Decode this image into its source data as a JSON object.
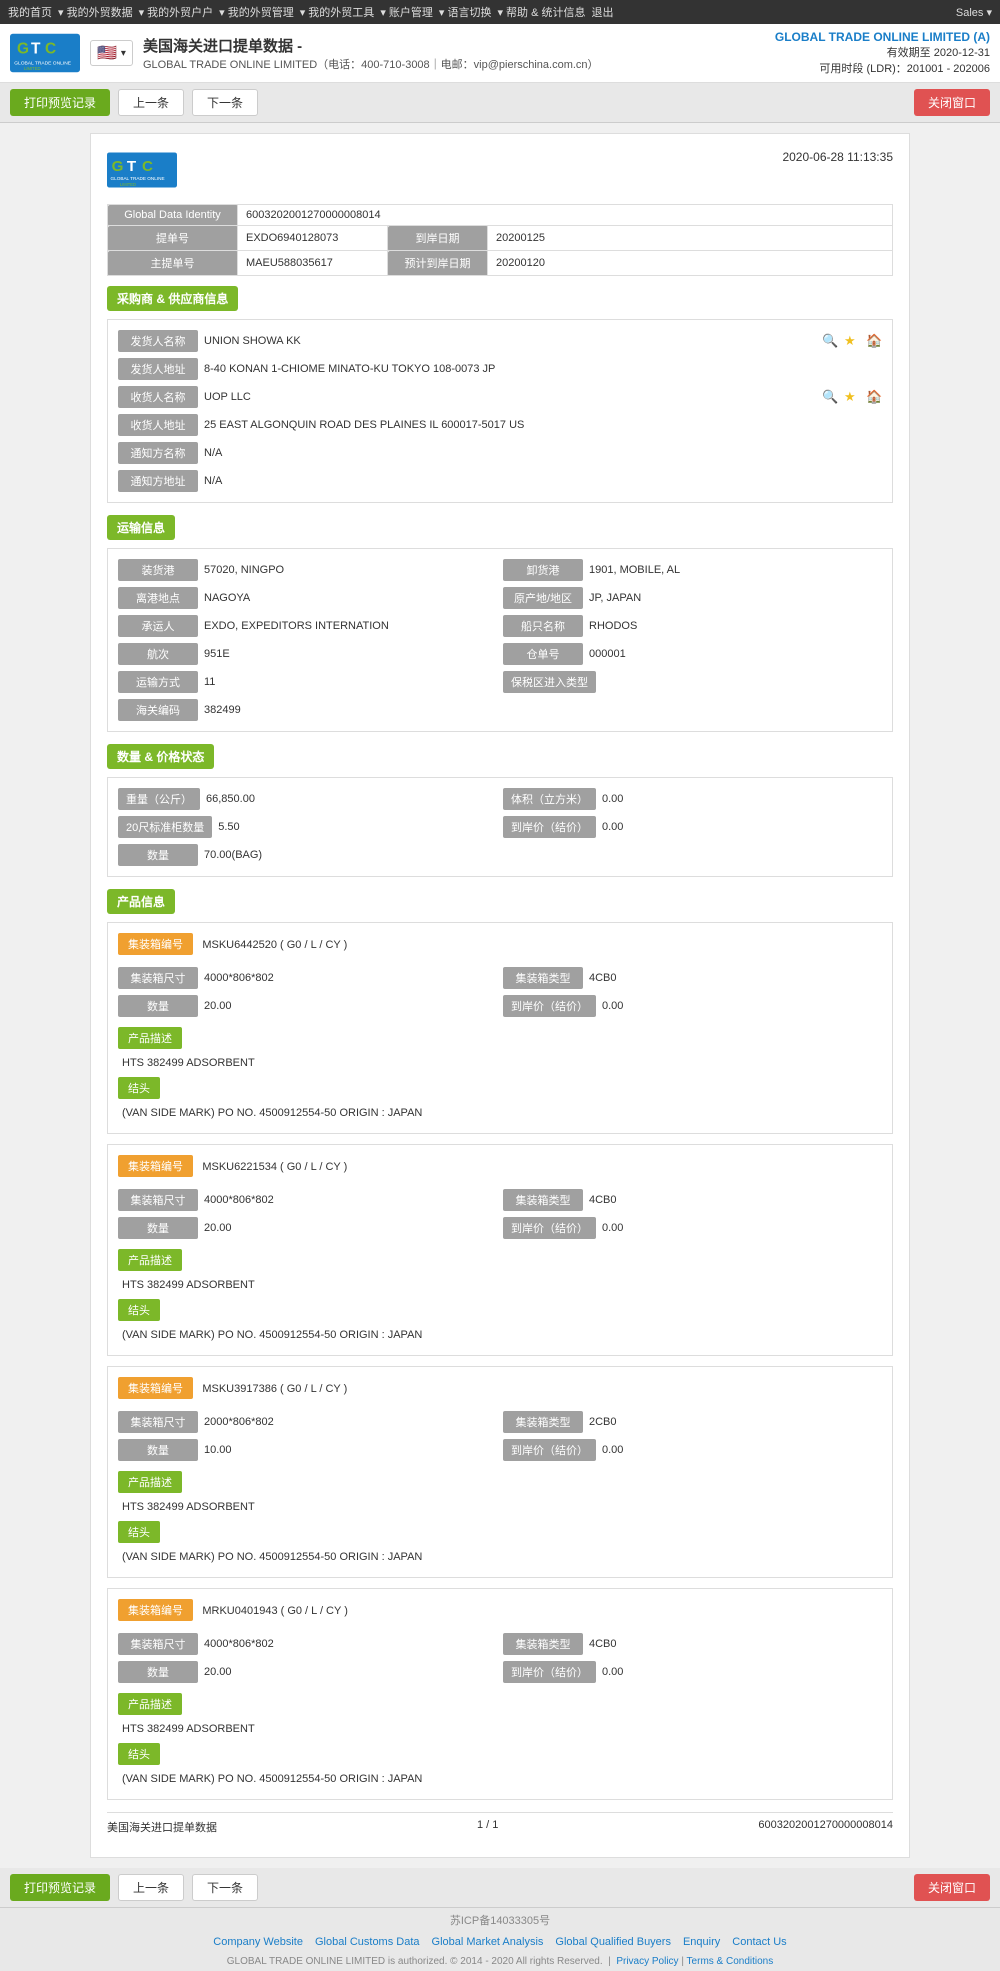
{
  "topnav": {
    "items": [
      "我的首页",
      "我的外贸数据",
      "我的外贸户户",
      "我的外贸管理",
      "我的外贸工具",
      "账户管理",
      "语言切换",
      "帮助 & 统计信息",
      "退出"
    ],
    "sales": "Sales"
  },
  "header": {
    "page_title": "美国海关进口提单数据 -",
    "company_line": "GLOBAL TRADE ONLINE LIMITED（电话：400-710-3008｜电邮：vip@pierschina.com.cn）",
    "company_name": "GLOBAL TRADE ONLINE LIMITED (A)",
    "valid_date": "有效期至 2020-12-31",
    "time_info": "可用时段 (LDR)：201001 - 202006"
  },
  "toolbar": {
    "print_label": "打印预览记录",
    "prev_label": "上一条",
    "next_label": "下一条",
    "close_label": "关闭窗口"
  },
  "document": {
    "date": "2020-06-28 11:13:35",
    "global_data_identity_label": "Global Data Identity",
    "global_data_identity_value": "6003202001270000008014",
    "fields": {
      "bill_no_label": "提单号",
      "bill_no_value": "EXDO6940128073",
      "arrival_date_label": "到岸日期",
      "arrival_date_value": "20200125",
      "master_bill_label": "主提单号",
      "master_bill_value": "MAEU588035617",
      "planned_arrival_label": "预计到岸日期",
      "planned_arrival_value": "20200120"
    }
  },
  "shipper_section": {
    "title": "采购商 & 供应商信息",
    "shipper_name_label": "发货人名称",
    "shipper_name_value": "UNION SHOWA KK",
    "shipper_addr_label": "发货人地址",
    "shipper_addr_value": "8-40 KONAN 1-CHIOME MINATO-KU TOKYO 108-0073 JP",
    "consignee_name_label": "收货人名称",
    "consignee_name_value": "UOP LLC",
    "consignee_addr_label": "收货人地址",
    "consignee_addr_value": "25 EAST ALGONQUIN ROAD DES PLAINES IL 600017-5017 US",
    "notify_name_label": "通知方名称",
    "notify_name_value": "N/A",
    "notify_addr_label": "通知方地址",
    "notify_addr_value": "N/A"
  },
  "logistics_section": {
    "title": "运输信息",
    "loading_port_label": "装货港",
    "loading_port_value": "57020, NINGPO",
    "unloading_port_label": "卸货港",
    "unloading_port_value": "1901, MOBILE, AL",
    "departure_place_label": "离港地点",
    "departure_place_value": "NAGOYA",
    "origin_country_label": "原产地/地区",
    "origin_country_value": "JP, JAPAN",
    "carrier_label": "承运人",
    "carrier_value": "EXDO, EXPEDITORS INTERNATION",
    "vessel_name_label": "船只名称",
    "vessel_name_value": "RHODOS",
    "voyage_label": "航次",
    "voyage_value": "951E",
    "bill_of_lading_label": "仓单号",
    "bill_of_lading_value": "000001",
    "transport_mode_label": "运输方式",
    "transport_mode_value": "11",
    "customs_zone_label": "保税区进入类型",
    "customs_zone_value": "",
    "customs_no_label": "海关编码",
    "customs_no_value": "382499"
  },
  "quantity_section": {
    "title": "数量 & 价格状态",
    "weight_label": "重量（公斤）",
    "weight_value": "66,850.00",
    "volume_label": "体积（立方米）",
    "volume_value": "0.00",
    "std_containers_label": "20尺标准柜数量",
    "std_containers_value": "5.50",
    "unit_price_label": "到岸价（结价）",
    "unit_price_value": "0.00",
    "quantity_label": "数量",
    "quantity_value": "70.00(BAG)"
  },
  "product_section": {
    "title": "产品信息",
    "items": [
      {
        "container_no_label": "集装箱编号",
        "container_no_value": "MSKU6442520 ( G0 / L / CY )",
        "container_size_label": "集装箱尺寸",
        "container_size_value": "4000*806*802",
        "container_type_label": "集装箱类型",
        "container_type_value": "4CB0",
        "quantity_label": "数量",
        "quantity_value": "20.00",
        "unit_price_label": "到岸价（结价）",
        "unit_price_value": "0.00",
        "desc_label": "产品描述",
        "desc_value": "HTS 382499 ADSORBENT",
        "mark_label": "结头",
        "mark_value": "(VAN SIDE MARK) PO NO. 4500912554-50 ORIGIN : JAPAN"
      },
      {
        "container_no_label": "集装箱编号",
        "container_no_value": "MSKU6221534 ( G0 / L / CY )",
        "container_size_label": "集装箱尺寸",
        "container_size_value": "4000*806*802",
        "container_type_label": "集装箱类型",
        "container_type_value": "4CB0",
        "quantity_label": "数量",
        "quantity_value": "20.00",
        "unit_price_label": "到岸价（结价）",
        "unit_price_value": "0.00",
        "desc_label": "产品描述",
        "desc_value": "HTS 382499 ADSORBENT",
        "mark_label": "结头",
        "mark_value": "(VAN SIDE MARK) PO NO. 4500912554-50 ORIGIN : JAPAN"
      },
      {
        "container_no_label": "集装箱编号",
        "container_no_value": "MSKU3917386 ( G0 / L / CY )",
        "container_size_label": "集装箱尺寸",
        "container_size_value": "2000*806*802",
        "container_type_label": "集装箱类型",
        "container_type_value": "2CB0",
        "quantity_label": "数量",
        "quantity_value": "10.00",
        "unit_price_label": "到岸价（结价）",
        "unit_price_value": "0.00",
        "desc_label": "产品描述",
        "desc_value": "HTS 382499 ADSORBENT",
        "mark_label": "结头",
        "mark_value": "(VAN SIDE MARK) PO NO. 4500912554-50 ORIGIN : JAPAN"
      },
      {
        "container_no_label": "集装箱编号",
        "container_no_value": "MRKU0401943 ( G0 / L / CY )",
        "container_size_label": "集装箱尺寸",
        "container_size_value": "4000*806*802",
        "container_type_label": "集装箱类型",
        "container_type_value": "4CB0",
        "quantity_label": "数量",
        "quantity_value": "20.00",
        "unit_price_label": "到岸价（结价）",
        "unit_price_value": "0.00",
        "desc_label": "产品描述",
        "desc_value": "HTS 382499 ADSORBENT",
        "mark_label": "结头",
        "mark_value": "(VAN SIDE MARK) PO NO. 4500912554-50 ORIGIN : JAPAN"
      }
    ]
  },
  "doc_footer": {
    "label": "美国海关进口提单数据",
    "page": "1 / 1",
    "id": "6003202001270000008014"
  },
  "footer": {
    "icp": "苏ICP备14033305号",
    "links": [
      "Company Website",
      "Global Customs Data",
      "Global Market Analysis",
      "Global Qualified Buyers",
      "Enquiry",
      "Contact Us"
    ],
    "copyright": "GLOBAL TRADE ONLINE LIMITED is authorized. © 2014 - 2020 All rights Reserved.",
    "policy_links": [
      "Privacy Policy",
      "Terms & Conditions"
    ]
  }
}
